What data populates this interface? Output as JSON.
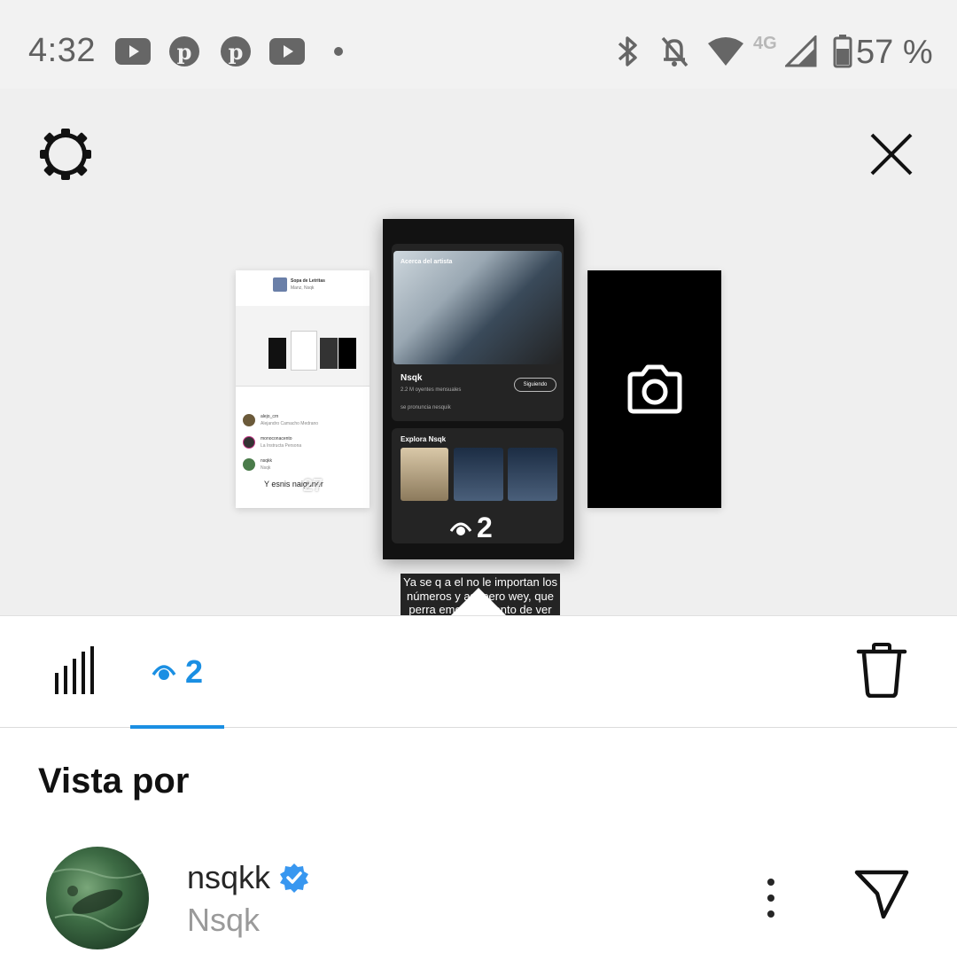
{
  "status_bar": {
    "time": "4:32",
    "network": "4G",
    "battery": "57 %",
    "left_icons": [
      "youtube-icon",
      "pinterest-icon",
      "pinterest-icon",
      "youtube-icon",
      "dot-icon"
    ],
    "right_icons": [
      "bluetooth-icon",
      "notifications-off-icon",
      "wifi-icon",
      "signal-icon",
      "battery-icon"
    ]
  },
  "preview": {
    "settings_icon": "gear-icon",
    "close_icon": "close-icon",
    "left_thumb": {
      "title": "Sopa de Letritas",
      "subtitle": "Manz, Nsqk",
      "rows": [
        {
          "name": "alejo_crn",
          "sub": "Alejandro Camacho Medrano"
        },
        {
          "name": "monoconacento",
          "sub": "La Instructa Persona"
        },
        {
          "name": "nsqkk",
          "sub": "Nsqk"
        }
      ],
      "caption": "Y esnis naiguner",
      "views": "27"
    },
    "center_thumb": {
      "section": "Acerca del artista",
      "artist": "Nsqk",
      "listeners": "2.2 M oyentes mensuales",
      "follow_label": "Siguiendo",
      "pronunciation": "se pronuncia nesquik",
      "explore": "Explora Nsqk",
      "caption": "Ya se q a el no le importan los números y así pero wey, que perra emoción siento de ver esos millones llegando, es el inicio del fucking goat 😢🔥",
      "views": "2"
    },
    "right_thumb": {
      "icon": "camera-icon"
    }
  },
  "tabs": {
    "stats_icon": "bar-chart-icon",
    "viewers_icon": "eye-icon",
    "viewers_count": "2",
    "trash_icon": "trash-icon"
  },
  "viewers": {
    "title": "Vista por",
    "list": [
      {
        "username": "nsqkk",
        "full_name": "Nsqk",
        "verified": true
      }
    ]
  },
  "colors": {
    "accent": "#1a8fe3",
    "verified": "#3897f0"
  }
}
